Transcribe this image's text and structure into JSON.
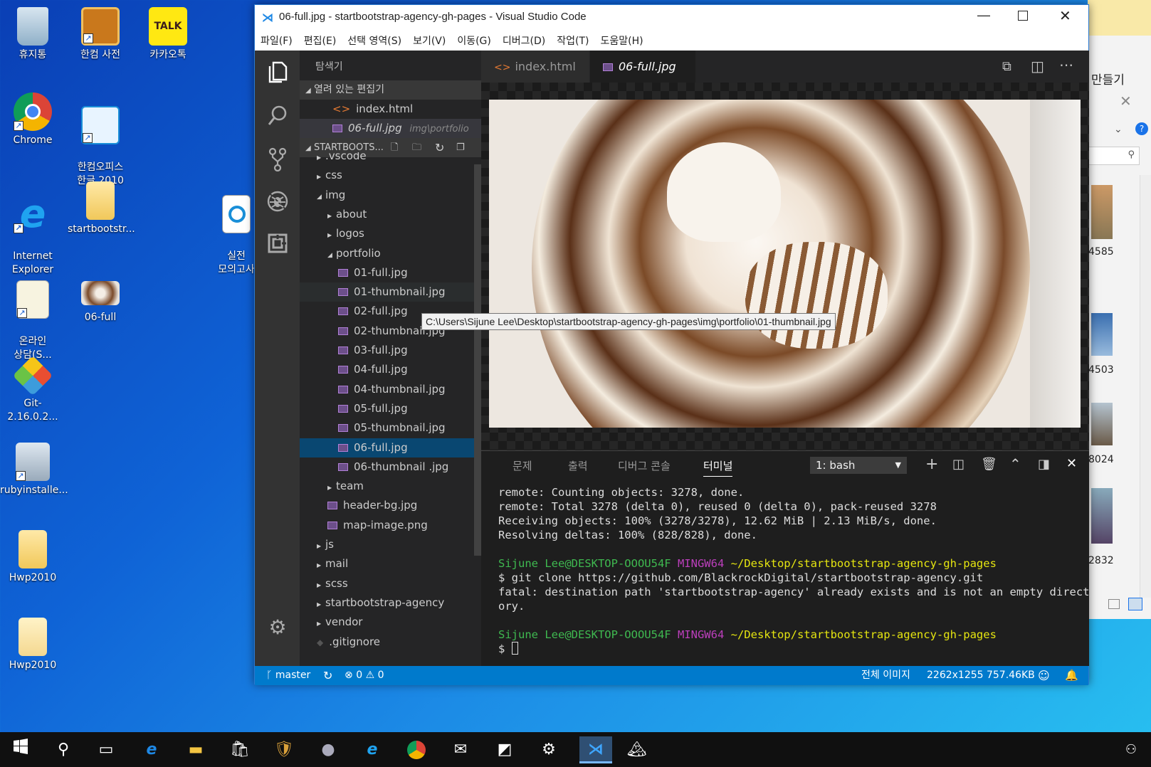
{
  "desktop": {
    "icons": [
      {
        "label": "휴지통"
      },
      {
        "label": "한컴 사전"
      },
      {
        "label": "카카오톡",
        "badge": "TALK"
      },
      {
        "label": "Chrome"
      },
      {
        "label": "한컴오피스\n한글 2010"
      },
      {
        "label": "Internet\nExplorer"
      },
      {
        "label": "startbootstr..."
      },
      {
        "label": "실전\n모의고사"
      },
      {
        "label": "온라인\n상담(S..."
      },
      {
        "label": "06-full"
      },
      {
        "label": "Git-2.16.0.2..."
      },
      {
        "label": "rubyinstalle..."
      },
      {
        "label": "Hwp2010"
      },
      {
        "label": "Hwp2010"
      }
    ]
  },
  "sidewindow": {
    "title_fragment": "만들기",
    "numbers": [
      "4585",
      "4503",
      "8024",
      "2832"
    ]
  },
  "window": {
    "title": "06-full.jpg - startbootstrap-agency-gh-pages - Visual Studio Code",
    "menu": [
      "파일(F)",
      "편집(E)",
      "선택 영역(S)",
      "보기(V)",
      "이동(G)",
      "디버그(D)",
      "작업(T)",
      "도움말(H)"
    ]
  },
  "sidebar": {
    "title": "탐색기",
    "open_editors_label": "열려 있는 편집기",
    "open_editors": [
      {
        "name": "index.html",
        "path": ""
      },
      {
        "name": "06-full.jpg",
        "path": "img\\portfolio"
      }
    ],
    "project_label": "STARTBOOTS...",
    "tree": [
      {
        "name": ".vscode",
        "depth": 0,
        "type": "folder",
        "open": false
      },
      {
        "name": "css",
        "depth": 0,
        "type": "folder",
        "open": false
      },
      {
        "name": "img",
        "depth": 0,
        "type": "folder",
        "open": true
      },
      {
        "name": "about",
        "depth": 1,
        "type": "folder",
        "open": false
      },
      {
        "name": "logos",
        "depth": 1,
        "type": "folder",
        "open": false
      },
      {
        "name": "portfolio",
        "depth": 1,
        "type": "folder",
        "open": true
      },
      {
        "name": "01-full.jpg",
        "depth": 2,
        "type": "image"
      },
      {
        "name": "01-thumbnail.jpg",
        "depth": 2,
        "type": "image"
      },
      {
        "name": "02-full.jpg",
        "depth": 2,
        "type": "image"
      },
      {
        "name": "02-thumbnail.jpg",
        "depth": 2,
        "type": "image"
      },
      {
        "name": "03-full.jpg",
        "depth": 2,
        "type": "image"
      },
      {
        "name": "04-full.jpg",
        "depth": 2,
        "type": "image"
      },
      {
        "name": "04-thumbnail.jpg",
        "depth": 2,
        "type": "image"
      },
      {
        "name": "05-full.jpg",
        "depth": 2,
        "type": "image"
      },
      {
        "name": "05-thumbnail.jpg",
        "depth": 2,
        "type": "image"
      },
      {
        "name": "06-full.jpg",
        "depth": 2,
        "type": "image",
        "selected": true
      },
      {
        "name": "06-thumbnail .jpg",
        "depth": 2,
        "type": "image"
      },
      {
        "name": "team",
        "depth": 1,
        "type": "folder",
        "open": false
      },
      {
        "name": "header-bg.jpg",
        "depth": 1,
        "type": "image"
      },
      {
        "name": "map-image.png",
        "depth": 1,
        "type": "image"
      },
      {
        "name": "js",
        "depth": 0,
        "type": "folder",
        "open": false
      },
      {
        "name": "mail",
        "depth": 0,
        "type": "folder",
        "open": false
      },
      {
        "name": "scss",
        "depth": 0,
        "type": "folder",
        "open": false
      },
      {
        "name": "startbootstrap-agency",
        "depth": 0,
        "type": "folder",
        "open": false
      },
      {
        "name": "vendor",
        "depth": 0,
        "type": "folder",
        "open": false
      },
      {
        "name": ".gitignore",
        "depth": 0,
        "type": "git"
      }
    ]
  },
  "tabs": [
    {
      "label": "index.html",
      "active": false
    },
    {
      "label": "06-full.jpg",
      "active": true
    }
  ],
  "tooltip": "C:\\Users\\Sijune Lee\\Desktop\\startbootstrap-agency-gh-pages\\img\\portfolio\\01-thumbnail.jpg",
  "panel": {
    "tabs": [
      "문제",
      "출력",
      "디버그 콘솔",
      "터미널"
    ],
    "active_tab": "터미널",
    "terminal_select": "1: bash",
    "lines": [
      {
        "t": "remote: Counting objects: 3278, done."
      },
      {
        "t": "remote: Total 3278 (delta 0), reused 0 (delta 0), pack-reused 3278"
      },
      {
        "t": "Receiving objects: 100% (3278/3278), 12.62 MiB | 2.13 MiB/s, done."
      },
      {
        "t": "Resolving deltas: 100% (828/828), done."
      },
      {
        "t": ""
      },
      {
        "prompt": true,
        "user": "Sijune Lee@DESKTOP-OOOU54F",
        "env": "MINGW64",
        "path": "~/Desktop/startbootstrap-agency-gh-pages"
      },
      {
        "t": "$ git clone https://github.com/BlackrockDigital/startbootstrap-agency.git"
      },
      {
        "t": "fatal: destination path 'startbootstrap-agency' already exists and is not an empty direct"
      },
      {
        "t": "ory."
      },
      {
        "t": ""
      },
      {
        "prompt": true,
        "user": "Sijune Lee@DESKTOP-OOOU54F",
        "env": "MINGW64",
        "path": "~/Desktop/startbootstrap-agency-gh-pages"
      },
      {
        "t": "$ ",
        "cursor": true
      }
    ]
  },
  "status": {
    "branch": "master",
    "errors": "0",
    "warnings": "0",
    "image_label": "전체 이미지",
    "image_info": "2262x1255 757.46KB"
  },
  "colors": {
    "accent": "#007acc",
    "term_user": "#3fb950",
    "term_env": "#bc3fbc",
    "term_path": "#e5e510"
  }
}
